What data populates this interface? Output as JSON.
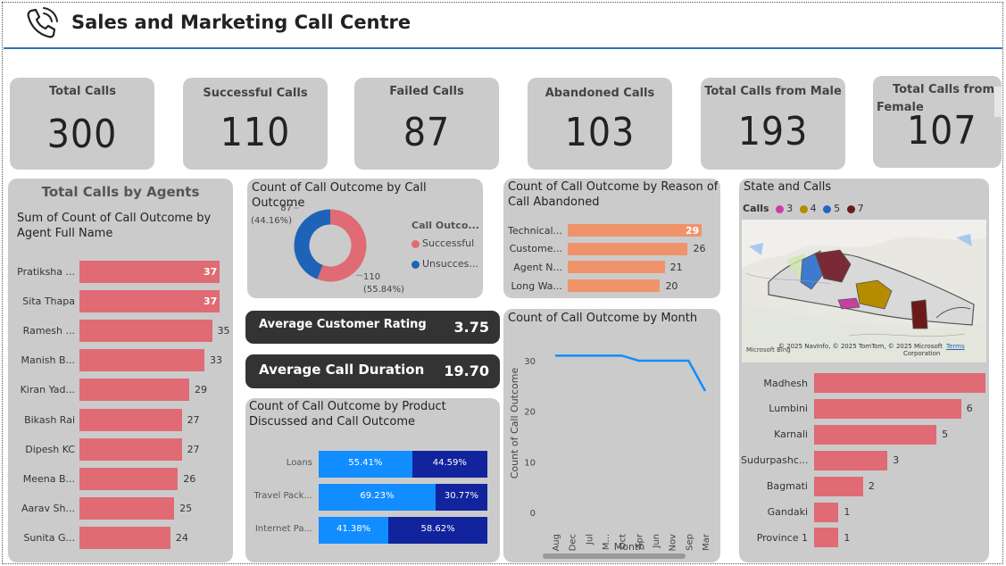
{
  "header": {
    "title": "Sales and Marketing Call Centre",
    "icon": "phone-icon"
  },
  "kpis": [
    {
      "label": "Total Calls",
      "value": "300"
    },
    {
      "label": "Successful Calls",
      "value": "110"
    },
    {
      "label": "Failed Calls",
      "value": "87"
    },
    {
      "label": "Abandoned Calls",
      "value": "103"
    },
    {
      "label": "Total Calls from Male",
      "value": "193"
    },
    {
      "label_line1": "Total Calls from",
      "label_line2": "Female",
      "value": "107"
    }
  ],
  "agents": {
    "title": "Total Calls by Agents",
    "subtitle": "Sum of Count of Call Outcome by Agent Full Name",
    "bar_color": "#e06b75",
    "chart_data": {
      "type": "bar",
      "categories": [
        "Pratiksha ...",
        "Sita Thapa",
        "Ramesh ...",
        "Manish B...",
        "Kiran Yad...",
        "Bikash Rai",
        "Dipesh KC",
        "Meena B...",
        "Aarav Sh...",
        "Sunita G..."
      ],
      "values": [
        37,
        37,
        35,
        33,
        29,
        27,
        27,
        26,
        25,
        24
      ]
    }
  },
  "donut": {
    "title": "Count of Call Outcome by Call Outcome",
    "legend_title": "Call Outco...",
    "chart_data": {
      "type": "pie",
      "series": [
        {
          "name": "Successful",
          "value": 110,
          "label": "110",
          "pct": "(55.84%)",
          "color": "#e06b75"
        },
        {
          "name": "Unsucces...",
          "value": 87,
          "label": "87",
          "pct": "(44.16%)",
          "color": "#1f63b8"
        }
      ]
    }
  },
  "rating": {
    "label": "Average Customer Rating",
    "value": "3.75"
  },
  "duration": {
    "label": "Average Call Duration",
    "value": "19.70"
  },
  "product": {
    "title": "Count of Call Outcome by Product Discussed and Call Outcome",
    "chart_data": {
      "type": "bar",
      "categories": [
        "Loans",
        "Travel Pack...",
        "Internet Pa..."
      ],
      "series": [
        {
          "name": "Successful",
          "values": [
            55.41,
            69.23,
            41.38
          ],
          "labels": [
            "55.41%",
            "69.23%",
            "41.38%"
          ],
          "color": "#118dff"
        },
        {
          "name": "Unsuccessful",
          "values": [
            44.59,
            30.77,
            58.62
          ],
          "labels": [
            "44.59%",
            "30.77%",
            "58.62%"
          ],
          "color": "#12239e"
        }
      ]
    }
  },
  "abandon": {
    "title": "Count of Call Outcome by Reason of Call Abandoned",
    "bar_color": "#f0936a",
    "chart_data": {
      "type": "bar",
      "categories": [
        "Technical...",
        "Custome...",
        "Agent N...",
        "Long Wa..."
      ],
      "values": [
        29,
        26,
        21,
        20
      ]
    }
  },
  "month": {
    "title": "Count of Call Outcome by Month",
    "chart_data": {
      "type": "line",
      "x": [
        "Aug",
        "Dec",
        "Jul",
        "M...",
        "Oct",
        "Apr",
        "Jun",
        "Nov",
        "Sep",
        "Mar"
      ],
      "y": [
        31,
        31,
        31,
        31,
        31,
        30,
        30,
        30,
        30,
        24
      ],
      "ylabel": "Count of Call Outcome",
      "xlabel": "Month",
      "ylim": [
        0,
        30
      ],
      "yticks": [
        "30",
        "20",
        "10",
        "0"
      ],
      "line_color": "#118dff"
    }
  },
  "state": {
    "title": "State and Calls",
    "legend_title": "Calls",
    "legend": [
      {
        "label": "3",
        "color": "#c83fa0"
      },
      {
        "label": "4",
        "color": "#b58b00"
      },
      {
        "label": "5",
        "color": "#2166c4"
      },
      {
        "label": "7",
        "color": "#6b1a1a"
      }
    ],
    "map_credit": "© 2025 NavInfo, © 2025 TomTom, © 2025 Microsoft",
    "map_credit_corp": "Corporation",
    "map_terms": "Terms",
    "map_logo": "Microsoft Bing",
    "bar_color": "#e06b75",
    "chart_data": {
      "type": "bar",
      "categories": [
        "Madhesh",
        "Lumbini",
        "Karnali",
        "Sudurpashc...",
        "Bagmati",
        "Gandaki",
        "Province 1"
      ],
      "values": [
        7,
        6,
        5,
        3,
        2,
        1,
        1
      ]
    }
  }
}
